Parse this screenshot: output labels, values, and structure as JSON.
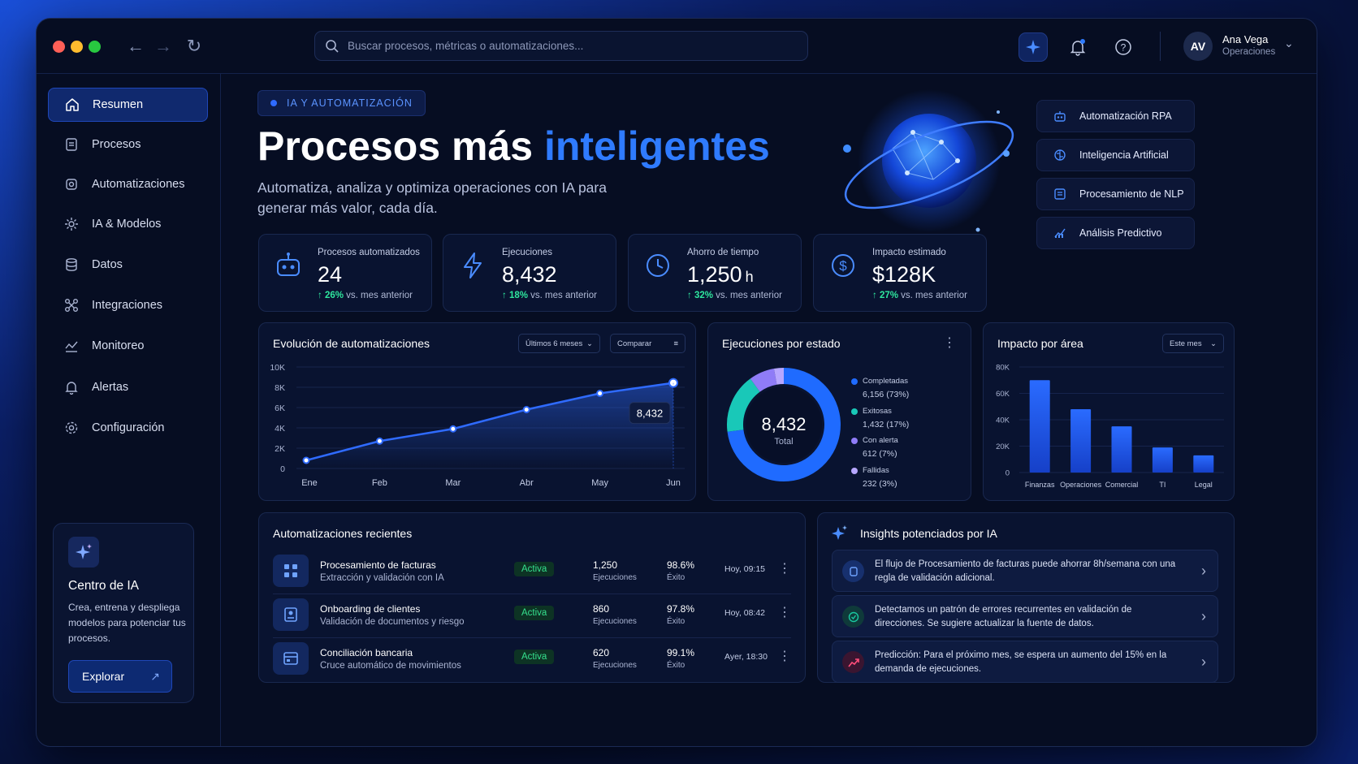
{
  "topbar": {
    "search_placeholder": "Buscar procesos, métricas o automatizaciones...",
    "user": {
      "initials": "AV",
      "name": "Ana Vega",
      "role": "Operaciones"
    }
  },
  "sidebar": {
    "items": [
      {
        "label": "Resumen",
        "icon": "home-icon"
      },
      {
        "label": "Procesos",
        "icon": "document-icon"
      },
      {
        "label": "Automatizaciones",
        "icon": "automation-icon"
      },
      {
        "label": "IA & Modelos",
        "icon": "ai-model-icon"
      },
      {
        "label": "Datos",
        "icon": "database-icon"
      },
      {
        "label": "Integraciones",
        "icon": "integrations-icon"
      },
      {
        "label": "Monitoreo",
        "icon": "monitor-icon"
      },
      {
        "label": "Alertas",
        "icon": "bell-icon"
      },
      {
        "label": "Configuración",
        "icon": "gear-icon"
      }
    ],
    "ai_card": {
      "title": "Centro de IA",
      "text": "Crea, entrena y despliega modelos para potenciar tus procesos.",
      "button": "Explorar"
    }
  },
  "hero": {
    "tag": "IA Y AUTOMATIZACIÓN",
    "title_a": "Procesos más ",
    "title_b": "inteligentes",
    "subtitle_1": "Automatiza, analiza y optimiza operaciones con IA para",
    "subtitle_2": "generar más valor, cada día."
  },
  "chips": [
    "Automatización RPA",
    "Inteligencia Artificial",
    "Procesamiento de NLP",
    "Análisis Predictivo"
  ],
  "stats": [
    {
      "label": "Procesos automatizados",
      "value": "24",
      "unit": "",
      "trend": "↑ 26%",
      "trend_text": " vs. mes anterior"
    },
    {
      "label": "Ejecuciones",
      "value": "8,432",
      "unit": "",
      "trend": "↑ 18%",
      "trend_text": " vs. mes anterior"
    },
    {
      "label": "Ahorro de tiempo",
      "value": "1,250",
      "unit": "h",
      "trend": "↑ 32%",
      "trend_text": " vs. mes anterior"
    },
    {
      "label": "Impacto estimado",
      "value": "$128K",
      "unit": "",
      "trend": "↑ 27%",
      "trend_text": " vs. mes anterior"
    }
  ],
  "line_panel": {
    "title": "Evolución de automatizaciones",
    "range": "Últimos 6 meses",
    "compare": "Comparar",
    "callout": "8,432"
  },
  "donut_panel": {
    "title": "Ejecuciones por estado",
    "center_value": "8,432",
    "center_label": "Total"
  },
  "bar_panel": {
    "title": "Impacto por área",
    "range": "Este mes"
  },
  "chart_data": [
    {
      "type": "line",
      "title": "Evolución de automatizaciones",
      "categories": [
        "Ene",
        "Feb",
        "Mar",
        "Abr",
        "May",
        "Jun"
      ],
      "values": [
        800,
        2700,
        3900,
        5800,
        7400,
        8432
      ],
      "yticks": [
        "10K",
        "8K",
        "6K",
        "4K",
        "2K",
        "0"
      ],
      "ylim": [
        0,
        10000
      ],
      "color": "#2f6bff"
    },
    {
      "type": "pie",
      "title": "Ejecuciones por estado",
      "slices": [
        {
          "name": "Completadas",
          "value": 6156,
          "label": "6,156 (73%)",
          "color": "#1f6bff"
        },
        {
          "name": "Exitosas",
          "value": 1432,
          "label": "1,432 (17%)",
          "color": "#19c8b8"
        },
        {
          "name": "Con alerta",
          "value": 612,
          "label": "612 (7%)",
          "color": "#8f7cf7"
        },
        {
          "name": "Fallidas",
          "value": 232,
          "label": "232 (3%)",
          "color": "#b7a7ff"
        }
      ]
    },
    {
      "type": "bar",
      "title": "Impacto por área",
      "categories": [
        "Finanzas",
        "Operaciones",
        "Comercial",
        "TI",
        "Legal"
      ],
      "values": [
        70000,
        48000,
        35000,
        19000,
        13000
      ],
      "yticks": [
        "80K",
        "60K",
        "40K",
        "20K",
        "0"
      ],
      "ylim": [
        0,
        80000
      ],
      "color": "#1f5cff"
    }
  ],
  "recent": {
    "title": "Automatizaciones recientes",
    "rows": [
      {
        "name": "Procesamiento de facturas",
        "desc": "Extracción y validación con IA",
        "status": "Activa",
        "runs": "1,250",
        "runs_label": "Ejecuciones",
        "success": "98.6%",
        "success_label": "Éxito",
        "time": "Hoy, 09:15"
      },
      {
        "name": "Onboarding de clientes",
        "desc": "Validación de documentos y riesgo",
        "status": "Activa",
        "runs": "860",
        "runs_label": "Ejecuciones",
        "success": "97.8%",
        "success_label": "Éxito",
        "time": "Hoy, 08:42"
      },
      {
        "name": "Conciliación bancaria",
        "desc": "Cruce automático de movimientos",
        "status": "Activa",
        "runs": "620",
        "runs_label": "Ejecuciones",
        "success": "99.1%",
        "success_label": "Éxito",
        "time": "Ayer, 18:30"
      }
    ]
  },
  "insights": {
    "title": "Insights potenciados por IA",
    "items": [
      {
        "text": "El flujo de Procesamiento de facturas puede ahorrar 8h/semana con una regla de validación adicional.",
        "icon": "lightbulb-icon",
        "color": "#2f6bff"
      },
      {
        "text": "Detectamos un patrón de errores recurrentes en validación de direcciones. Se sugiere actualizar la fuente de datos.",
        "icon": "shield-check-icon",
        "color": "#19c8a0"
      },
      {
        "text": "Predicción: Para el próximo mes, se espera un aumento del 15% en la demanda de ejecuciones.",
        "icon": "trend-up-icon",
        "color": "#ff4d7a"
      }
    ]
  }
}
